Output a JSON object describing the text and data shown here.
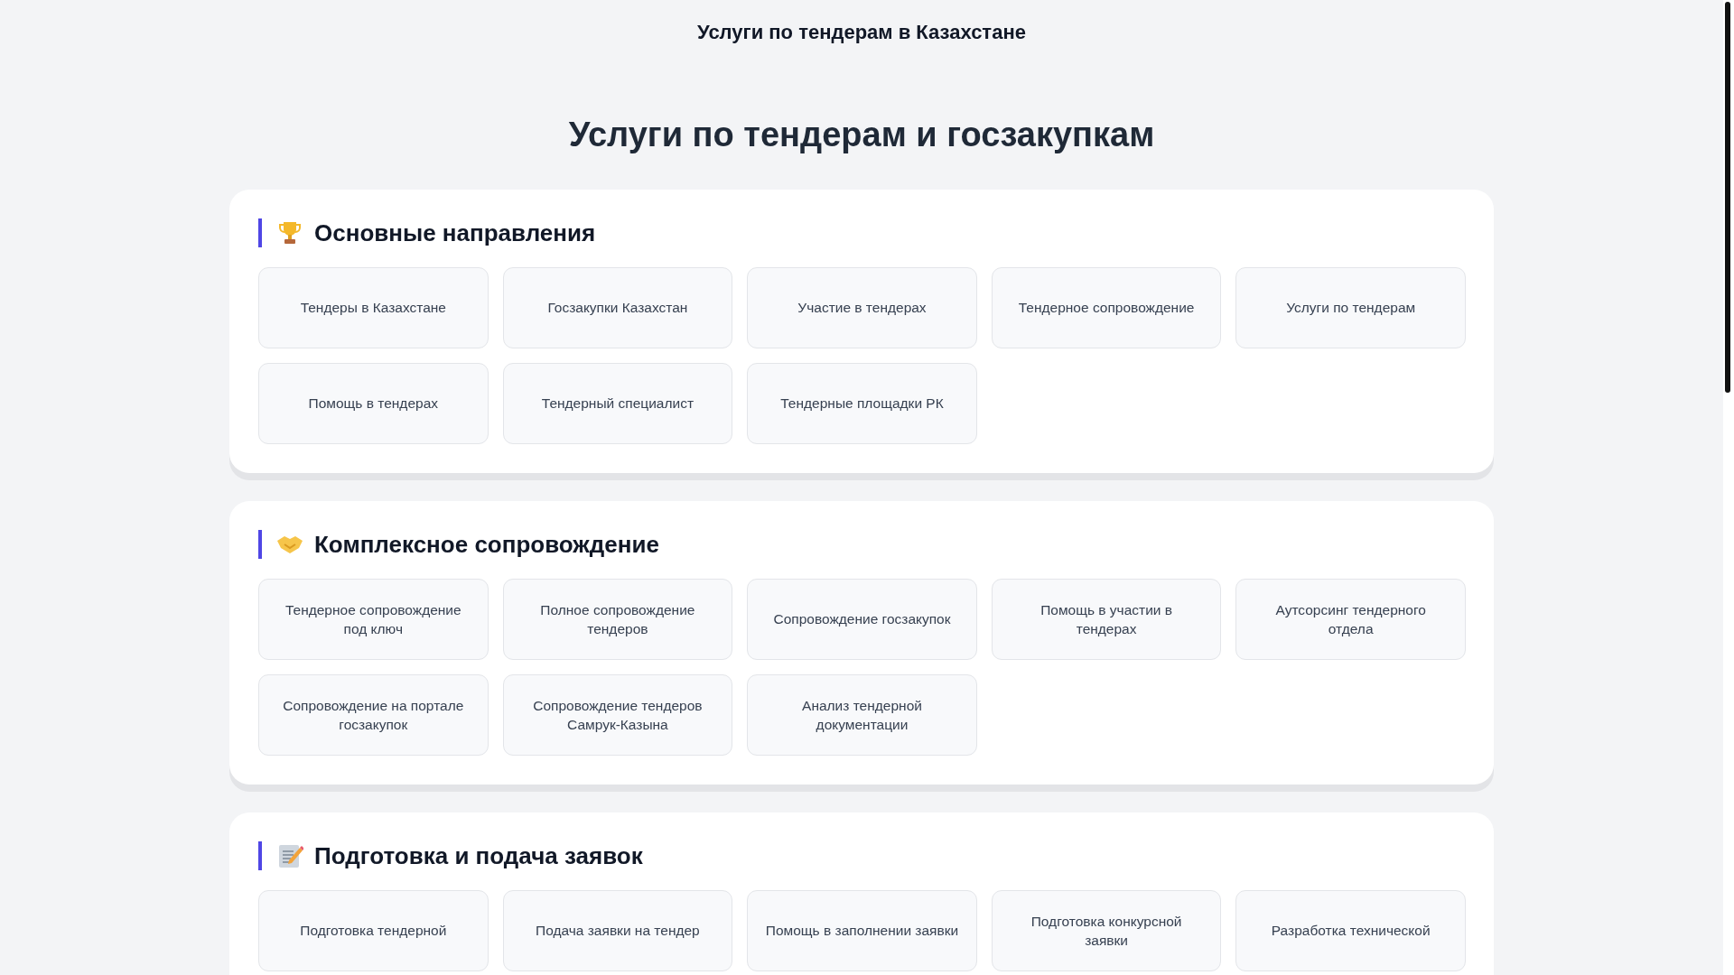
{
  "site_title": "Услуги по тендерам в Казахстане",
  "page_title": "Услуги по тендерам и госзакупкам",
  "sections": [
    {
      "title": "Основные направления",
      "items": [
        "Тендеры в Казахстане",
        "Госзакупки Казахстан",
        "Участие в тендерах",
        "Тендерное сопровождение",
        "Услуги по тендерам",
        "Помощь в тендерах",
        "Тендерный специалист",
        "Тендерные площадки РК"
      ]
    },
    {
      "title": "Комплексное сопровождение",
      "items": [
        "Тендерное сопровождение под ключ",
        "Полное сопровождение тендеров",
        "Сопровождение госзакупок",
        "Помощь в участии в тендерах",
        "Аутсорсинг тендерного отдела",
        "Сопровождение на портале госзакупок",
        "Сопровождение тендеров Самрук-Казына",
        "Анализ тендерной документации"
      ]
    },
    {
      "title": "Подготовка и подача заявок",
      "items": [
        "Подготовка тендерной",
        "Подача заявки на тендер",
        "Помощь в заполнении заявки",
        "Подготовка конкурсной заявки",
        "Разработка технической"
      ]
    }
  ]
}
